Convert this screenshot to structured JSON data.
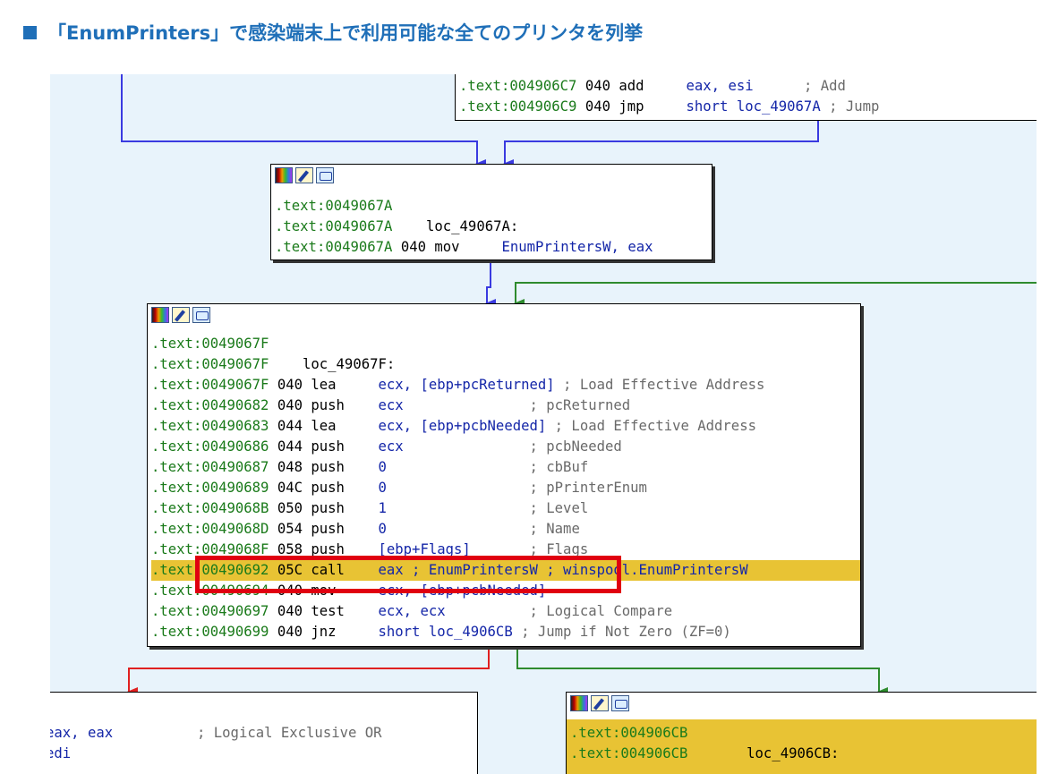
{
  "heading": "■ 「EnumPrinters」で感染端末上で利用可能な全てのプリンタを列挙",
  "colors": {
    "address": "#1a7a1a",
    "register": "#1426a8",
    "comment": "#6a6a6a",
    "highlight": "#e8c334",
    "graph_bg": "#e8f3fb",
    "edge_blue": "#3a3ae0",
    "edge_green": "#2e8b2e",
    "edge_red": "#e02020",
    "callout": "#e00010"
  },
  "toolbar_icons": [
    "color-palette-icon",
    "edit-pen-icon",
    "graph-view-icon"
  ],
  "nodes": {
    "top": {
      "lines": [
        {
          "addr": ".text:004906C7",
          "sp": "040",
          "op": "add",
          "args": "eax, esi     ",
          "cmt": "; Add"
        },
        {
          "addr": ".text:004906C9",
          "sp": "040",
          "op": "jmp",
          "args": "short loc_49067A",
          "cmt": "; Jump"
        }
      ]
    },
    "loc_49067A": {
      "lines": [
        {
          "addr": ".text:0049067A",
          "sp": "",
          "op": "",
          "args": "",
          "cmt": ""
        },
        {
          "addr": ".text:0049067A",
          "sp": "",
          "op": "",
          "args": "   loc_49067A:",
          "cmt": ""
        },
        {
          "addr": ".text:0049067A",
          "sp": "040",
          "op": "mov",
          "args": "EnumPrintersW, eax",
          "cmt": ""
        }
      ]
    },
    "loc_49067F": {
      "lines": [
        {
          "addr": ".text:0049067F",
          "sp": "",
          "op": "",
          "args": "",
          "cmt": "",
          "hl": false
        },
        {
          "addr": ".text:0049067F",
          "sp": "",
          "op": "",
          "args": "   loc_49067F:",
          "cmt": "",
          "hl": false
        },
        {
          "addr": ".text:0049067F",
          "sp": "040",
          "op": "lea ",
          "args": "ecx, [ebp+pcReturned]",
          "cmt": "; Load Effective Address",
          "hl": false
        },
        {
          "addr": ".text:00490682",
          "sp": "040",
          "op": "push",
          "args": "ecx              ",
          "cmt": "; pcReturned",
          "hl": false
        },
        {
          "addr": ".text:00490683",
          "sp": "044",
          "op": "lea ",
          "args": "ecx, [ebp+pcbNeeded]",
          "cmt": "; Load Effective Address",
          "hl": false
        },
        {
          "addr": ".text:00490686",
          "sp": "044",
          "op": "push",
          "args": "ecx              ",
          "cmt": "; pcbNeeded",
          "hl": false
        },
        {
          "addr": ".text:00490687",
          "sp": "048",
          "op": "push",
          "args": "0                ",
          "cmt": "; cbBuf",
          "hl": false
        },
        {
          "addr": ".text:00490689",
          "sp": "04C",
          "op": "push",
          "args": "0                ",
          "cmt": "; pPrinterEnum",
          "hl": false
        },
        {
          "addr": ".text:0049068B",
          "sp": "050",
          "op": "push",
          "args": "1                ",
          "cmt": "; Level",
          "hl": false
        },
        {
          "addr": ".text:0049068D",
          "sp": "054",
          "op": "push",
          "args": "0                ",
          "cmt": "; Name",
          "hl": false
        },
        {
          "addr": ".text:0049068F",
          "sp": "058",
          "op": "push",
          "args": "[ebp+Flags]      ",
          "cmt": "; Flags",
          "hl": false
        },
        {
          "addr": ".text:00490692",
          "sp": "05C",
          "op": "call",
          "args": "eax ; EnumPrintersW ;",
          "cmt": "winspool.EnumPrintersW",
          "hl": true
        },
        {
          "addr": ".text:00490694",
          "sp": "040",
          "op": "mov ",
          "args": "ecx, [ebp+pcbNeeded]",
          "cmt": "",
          "hl": false
        },
        {
          "addr": ".text:00490697",
          "sp": "040",
          "op": "test",
          "args": "ecx, ecx         ",
          "cmt": "; Logical Compare",
          "hl": false
        },
        {
          "addr": ".text:00490699",
          "sp": "040",
          "op": "jnz ",
          "args": "short loc_4906CB",
          "cmt": "; Jump if Not Zero (ZF=0)",
          "hl": false
        }
      ]
    },
    "bottom_left": {
      "lines": [
        {
          "addr": "",
          "sp": "",
          "op": "",
          "args": "eax, eax         ",
          "cmt": "; Logical Exclusive OR"
        },
        {
          "addr": "",
          "sp": "",
          "op": "",
          "args": "edi",
          "cmt": ""
        }
      ]
    },
    "loc_4906CB": {
      "lines": [
        {
          "addr": ".text:004906CB",
          "sp": "",
          "op": "",
          "args": "",
          "cmt": ""
        },
        {
          "addr": ".text:004906CB",
          "sp": "",
          "op": "",
          "args": "      loc_4906CB:",
          "cmt": ""
        }
      ]
    }
  }
}
